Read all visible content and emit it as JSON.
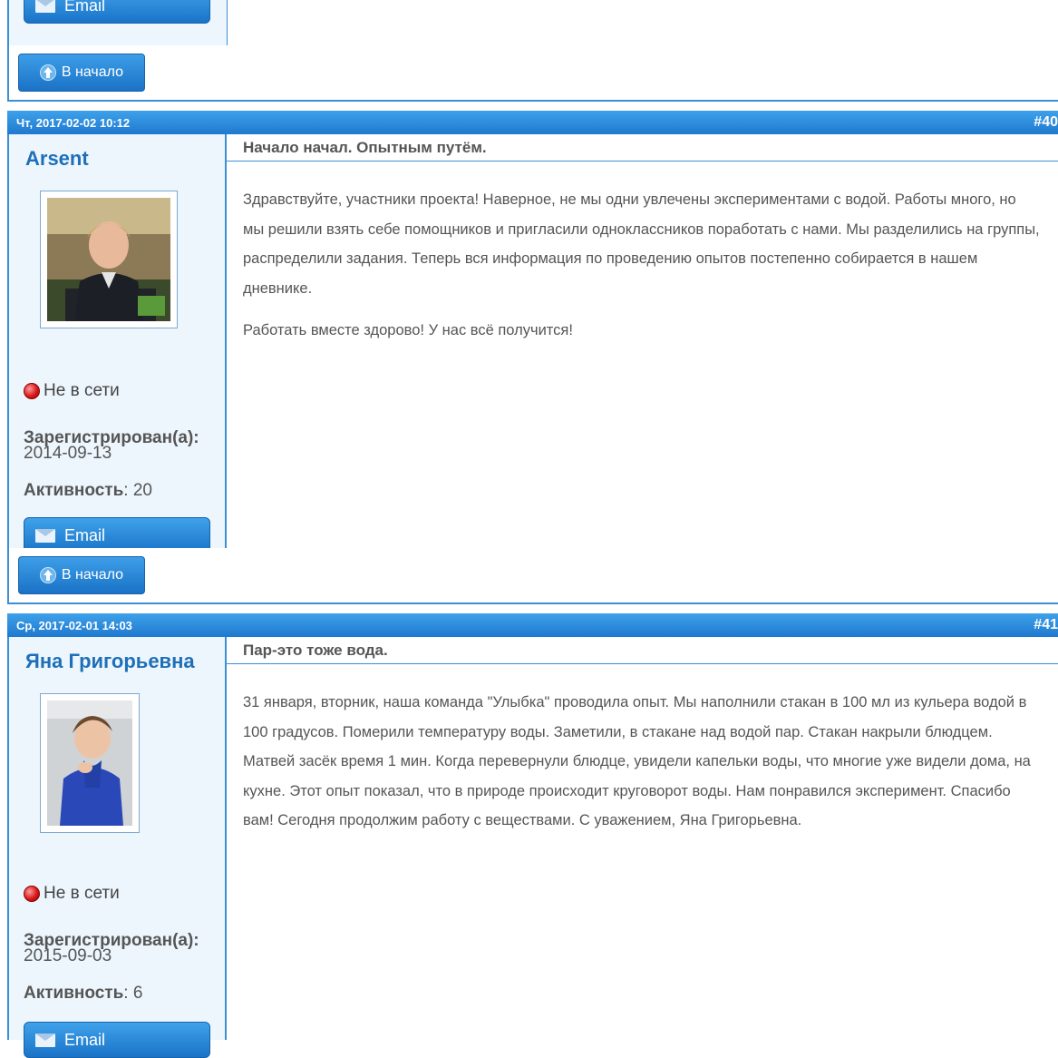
{
  "top_partial": {
    "email_label": "Email",
    "top_button_label": "В начало"
  },
  "posts": [
    {
      "date": "Чт, 2017-02-02 10:12",
      "number": "#40",
      "author": "Arsent",
      "status": "Не в сети",
      "registered_label": "Зарегистрирован(а):",
      "registered_date": "2014-09-13",
      "activity_label": "Активность",
      "activity_value": ": 20",
      "email_label": "Email",
      "title": "Начало начал. Опытным путём.",
      "paragraphs": [
        "Здравствуйте, участники проекта! Наверное, не мы одни увлечены экспериментами с водой. Работы много, но мы решили взять себе помощников и пригласили одноклассников поработать с нами. Мы разделились на группы, распределили задания. Теперь вся информация по проведению опытов постепенно собирается в нашем дневнике.",
        "Работать вместе здорово! У нас всё получится!"
      ],
      "top_button_label": "В начало"
    },
    {
      "date": "Ср, 2017-02-01 14:03",
      "number": "#41",
      "author": "Яна Григорьевна",
      "status": "Не в сети",
      "registered_label": "Зарегистрирован(а):",
      "registered_date": "2015-09-03",
      "activity_label": "Активность",
      "activity_value": ": 6",
      "email_label": "Email",
      "title": "Пар-это тоже вода.",
      "paragraphs": [
        "31 января, вторник, наша команда \"Улыбка\" проводила опыт. Мы наполнили стакан в 100 мл из кульера водой в 100 градусов. Померили температуру воды. Заметили, в стакане над водой пар. Стакан накрыли блюдцем. Матвей засёк время 1 мин. Когда перевернули блюдце, увидели капельки воды, что многие уже видели дома, на кухне. Этот опыт  показал, что в природе происходит круговорот воды. Нам понравился эксперимент. Спасибо вам! Сегодня продолжим работу с веществами. С уважением, Яна Григорьевна."
      ]
    }
  ]
}
